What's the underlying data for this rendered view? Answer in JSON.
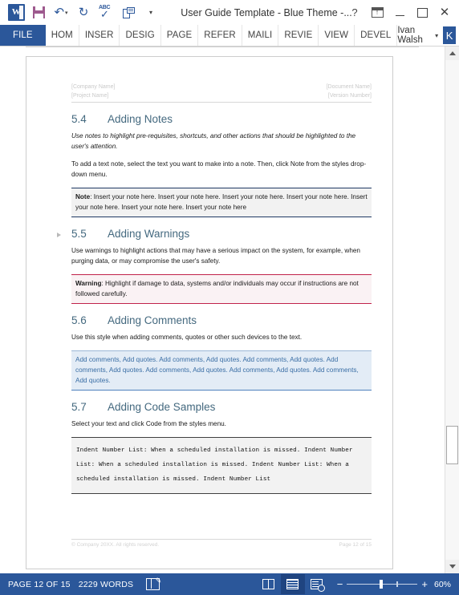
{
  "window": {
    "title": "User Guide Template - Blue Theme -...",
    "quick_access": [
      {
        "name": "word-app-icon",
        "label": "W"
      },
      {
        "name": "save-icon",
        "label": "Save"
      },
      {
        "name": "undo-icon",
        "label": "Undo"
      },
      {
        "name": "redo-icon",
        "label": "Redo"
      },
      {
        "name": "spelling-icon",
        "label": "ABC"
      },
      {
        "name": "print-preview-icon",
        "label": "Print Preview"
      },
      {
        "name": "customize-qat-icon",
        "label": "Customize"
      }
    ],
    "controls": {
      "help": "?",
      "ribbon_display_options": "Ribbon Display Options",
      "minimize": "Minimize",
      "restore": "Restore Down",
      "close": "Close"
    }
  },
  "ribbon": {
    "tabs": [
      {
        "label": "FILE",
        "active": true
      },
      {
        "label": "HOM",
        "active": false
      },
      {
        "label": "INSER",
        "active": false
      },
      {
        "label": "DESIG",
        "active": false
      },
      {
        "label": "PAGE",
        "active": false
      },
      {
        "label": "REFER",
        "active": false
      },
      {
        "label": "MAILI",
        "active": false
      },
      {
        "label": "REVIE",
        "active": false
      },
      {
        "label": "VIEW",
        "active": false
      },
      {
        "label": "DEVEL",
        "active": false
      }
    ],
    "user": {
      "name": "Ivan Walsh",
      "avatar_initial": "K"
    }
  },
  "document": {
    "header": {
      "left_line1": "[Company Name]",
      "left_line2": "[Project Name]",
      "right_line1": "[Document Name]",
      "right_line2": "[Version Number]"
    },
    "sections": [
      {
        "number": "5.4",
        "title": "Adding Notes",
        "paragraphs": [
          "Use notes to highlight pre-requisites, shortcuts, and other actions that should be highlighted to the user's attention.",
          "To add a text note, select the text you want to make into a note. Then, click Note from the styles drop-down menu."
        ],
        "callout_label": "Note",
        "callout_text": ": Insert your note here. Insert your note here. Insert your note here. Insert your note here. Insert your note here. Insert your note here. Insert your note here"
      },
      {
        "number": "5.5",
        "title": "Adding Warnings",
        "paragraphs": [
          "Use warnings to highlight actions that may have a serious impact on the system, for example, when purging data, or may compromise the user's safety."
        ],
        "callout_label": "Warning",
        "callout_text": ": Highlight if damage to data, systems and/or individuals may occur if instructions are not followed carefully."
      },
      {
        "number": "5.6",
        "title": "Adding Comments",
        "paragraphs": [
          "Use this style when adding comments, quotes or other such devices to the text."
        ],
        "callout_text": "Add comments, Add quotes. Add comments, Add quotes. Add comments, Add quotes. Add comments, Add quotes. Add comments, Add quotes. Add comments, Add quotes. Add comments, Add quotes."
      },
      {
        "number": "5.7",
        "title": "Adding Code Samples",
        "paragraphs": [
          "Select your text and click Code from the styles menu."
        ],
        "callout_text": "Indent Number List: When a scheduled installation is missed. Indent Number List: When a scheduled installation is missed. Indent Number List: When a scheduled installation is missed. Indent Number List"
      }
    ],
    "footer": {
      "left": "© Company 20XX. All rights reserved.",
      "right": "Page 12 of 15"
    }
  },
  "statusbar": {
    "page_info": "PAGE 12 OF 15",
    "word_count": "2229 WORDS",
    "proofing_icon": "proofing-errors-icon",
    "views": [
      {
        "name": "read-mode-view",
        "label": "Read Mode",
        "active": false
      },
      {
        "name": "print-layout-view",
        "label": "Print Layout",
        "active": true
      },
      {
        "name": "web-layout-view",
        "label": "Web Layout",
        "active": false
      }
    ],
    "zoom_out": "−",
    "zoom_in": "+",
    "zoom_level": "60%"
  },
  "colors": {
    "word_blue": "#2b579a",
    "heading_blue": "#44697f",
    "note_border": "#1f3864",
    "warning_border": "#c0224a",
    "comment_text": "#3a6ea5"
  }
}
